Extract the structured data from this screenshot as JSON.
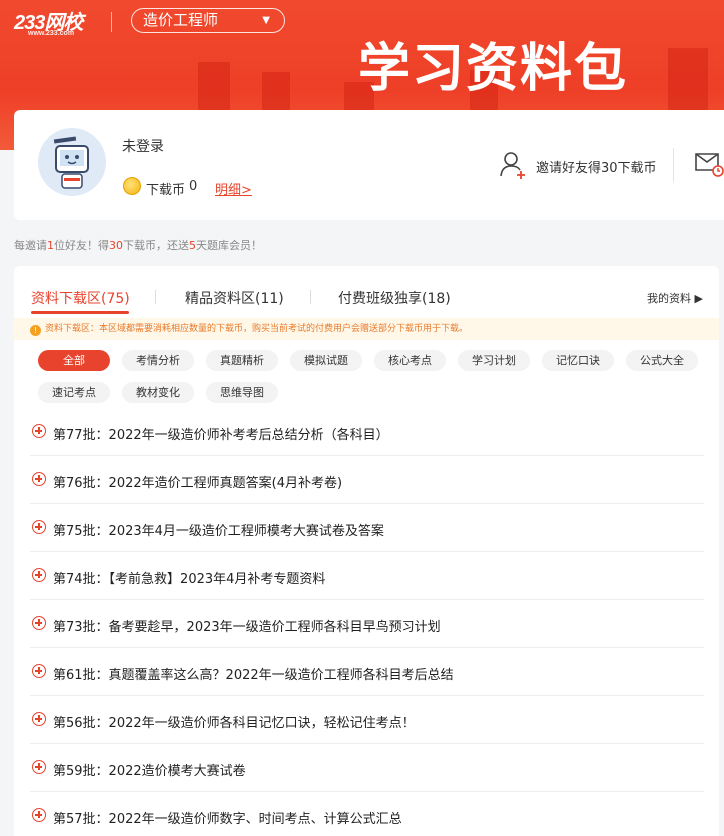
{
  "header": {
    "logo": "233网校",
    "logo_url": "www.233.com",
    "subject": "造价工程师",
    "banner_title": "学习资料包"
  },
  "user": {
    "name": "未登录",
    "coin_label": "下载币",
    "coin_count": "0",
    "detail_link": "明细>",
    "invite_text": "邀请好友得30下载币"
  },
  "invite_hint": {
    "p1": "每邀请",
    "n1": "1",
    "p2": "位好友！得",
    "n2": "30",
    "p3": "下载币，还送",
    "n3": "5",
    "p4": "天题库会员！"
  },
  "tabs": [
    {
      "label": "资料下载区(75)"
    },
    {
      "label": "精品资料区(11)"
    },
    {
      "label": "付费班级独享(18)"
    }
  ],
  "my_files": "我的资料 ▶",
  "notice": "资料下载区：本区域都需要消耗相应数量的下载币，购买当前考试的付费用户会赠送部分下载币用于下载。",
  "filters": [
    "全部",
    "考情分析",
    "真题精析",
    "模拟试题",
    "核心考点",
    "学习计划",
    "记忆口诀",
    "公式大全",
    "速记考点",
    "教材变化",
    "思维导图"
  ],
  "items": [
    "第77批：2022年一级造价师补考考后总结分析（各科目）",
    "第76批：2022年造价工程师真题答案(4月补考卷)",
    "第75批：2023年4月一级造价工程师模考大赛试卷及答案",
    "第74批：【考前急救】2023年4月补考专题资料",
    "第73批：备考要趁早，2023年一级造价工程师各科目早鸟预习计划",
    "第61批：真题覆盖率这么高？2022年一级造价工程师各科目考后总结",
    "第56批：2022年一级造价师各科目记忆口诀，轻松记住考点！",
    "第59批：2022造价模考大赛试卷",
    "第57批：2022年一级造价师数字、时间考点、计算公式汇总"
  ],
  "colors": {
    "brand": "#e8432c",
    "banner": "#ee3f27"
  }
}
